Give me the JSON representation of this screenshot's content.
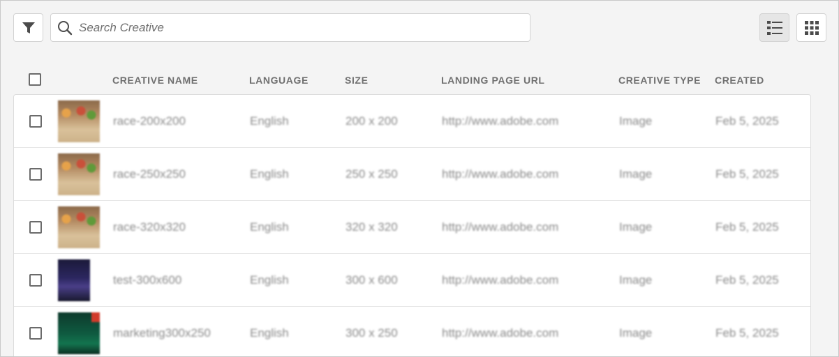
{
  "toolbar": {
    "search_placeholder": "Search Creative"
  },
  "table": {
    "headers": {
      "creative_name": "CREATIVE NAME",
      "language": "LANGUAGE",
      "size": "SIZE",
      "landing_page_url": "LANDING PAGE URL",
      "creative_type": "CREATIVE TYPE",
      "created": "CREATED"
    },
    "rows": [
      {
        "name": "race-200x200",
        "language": "English",
        "size": "200 x 200",
        "url": "http://www.adobe.com",
        "type": "Image",
        "created": "Feb 5, 2025"
      },
      {
        "name": "race-250x250",
        "language": "English",
        "size": "250 x 250",
        "url": "http://www.adobe.com",
        "type": "Image",
        "created": "Feb 5, 2025"
      },
      {
        "name": "race-320x320",
        "language": "English",
        "size": "320 x 320",
        "url": "http://www.adobe.com",
        "type": "Image",
        "created": "Feb 5, 2025"
      },
      {
        "name": "test-300x600",
        "language": "English",
        "size": "300 x 600",
        "url": "http://www.adobe.com",
        "type": "Image",
        "created": "Feb 5, 2025"
      },
      {
        "name": "marketing300x250",
        "language": "English",
        "size": "300 x 250",
        "url": "http://www.adobe.com",
        "type": "Image",
        "created": "Feb 5, 2025"
      }
    ]
  },
  "icons": {
    "filter": "filter-icon",
    "search": "search-icon",
    "list_view": "list-view-icon",
    "grid_view": "grid-view-icon"
  },
  "colors": {
    "background": "#f4f4f4",
    "header_text": "#707070",
    "body_text": "#8a8a8a",
    "active_view": "#e6e6e6"
  }
}
